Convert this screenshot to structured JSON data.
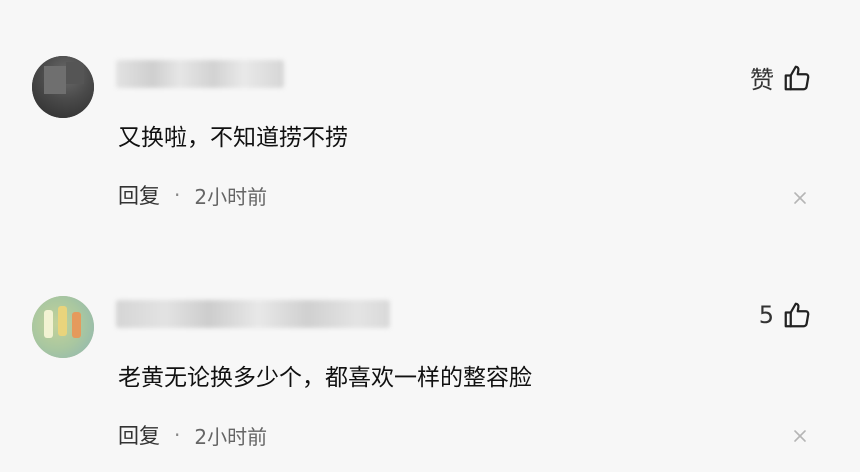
{
  "comments": [
    {
      "likes_label": "赞",
      "text": "又换啦，不知道捞不捞",
      "reply_label": "回复",
      "separator": "·",
      "time": "2小时前",
      "icons": {
        "like": "thumbs-up-icon",
        "close": "close-icon"
      }
    },
    {
      "likes_label": "5",
      "text": "老黄无论换多少个，都喜欢一样的整容脸",
      "reply_label": "回复",
      "separator": "·",
      "time": "2小时前",
      "icons": {
        "like": "thumbs-up-icon",
        "close": "close-icon"
      }
    }
  ]
}
